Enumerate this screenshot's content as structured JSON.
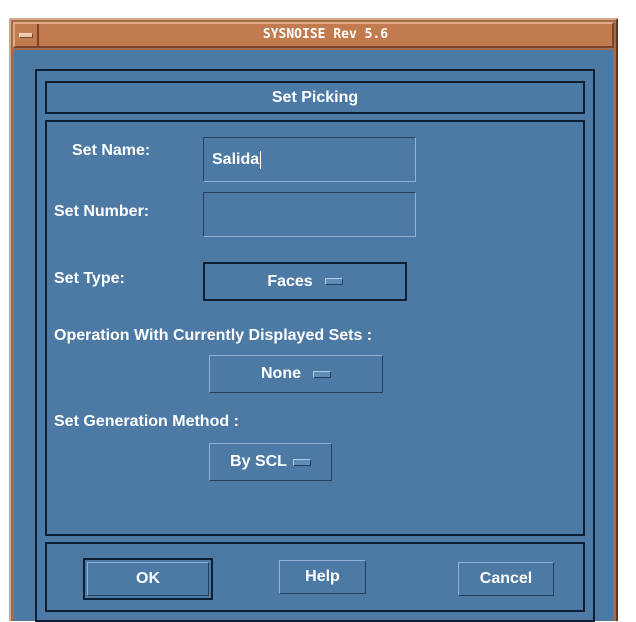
{
  "window": {
    "title": "SYSNOISE Rev 5.6"
  },
  "dialog": {
    "heading": "Set Picking",
    "set_name": {
      "label": "Set Name:",
      "value": "Salida"
    },
    "set_number": {
      "label": "Set Number:",
      "value": ""
    },
    "set_type": {
      "label": "Set Type:",
      "selected": "Faces"
    },
    "operation": {
      "label": "Operation With Currently Displayed Sets :",
      "selected": "None"
    },
    "generation": {
      "label": "Set Generation Method :",
      "selected": "By SCL"
    },
    "buttons": {
      "ok": "OK",
      "help": "Help",
      "cancel": "Cancel"
    }
  },
  "colors": {
    "window_frame": "#a06e4e",
    "title_bar": "#c27a4f",
    "dialog_bg": "#4c7aa5",
    "dark_line": "#0f1f33",
    "text": "#ffffff"
  }
}
